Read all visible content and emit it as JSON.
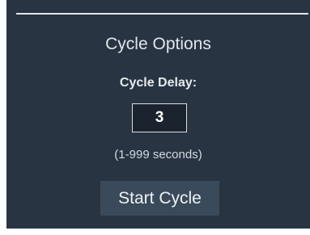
{
  "panel": {
    "title": "Cycle Options",
    "delay_label": "Cycle Delay:",
    "delay_value": "3",
    "range_hint": "(1-999 seconds)",
    "start_button_label": "Start Cycle"
  },
  "colors": {
    "panel_background": "#283442",
    "input_background": "#1b232e",
    "button_background": "#3a4a5b",
    "text": "#e1e6eb"
  }
}
